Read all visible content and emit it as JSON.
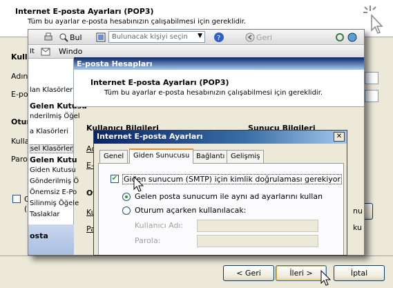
{
  "background_wizard": {
    "title": "Internet E-posta Ayarları (POP3)",
    "subtitle": "Tüm bu ayarlar e-posta hesabınızın çalışabilmesi için gereklidir.",
    "labels": [
      "Kull",
      "Adınız",
      "E-pos",
      "Otur",
      "Kullan",
      "Parol"
    ],
    "checkbox_fragment": "G",
    "paren_fragment": "(S",
    "back_button": "< Geri",
    "next_button": "İleri >",
    "cancel_button": "İptal"
  },
  "outlook": {
    "toolbar1": {
      "find_button": "Bul",
      "contact_search_placeholder": "Bulunacak kişiyi seçin",
      "back_button": "Geri"
    },
    "toolbar2": {
      "it_label": "It",
      "window_label": "Windo"
    },
    "folders": [
      "lan Klasörler",
      "Gelen Kutusu",
      "nderilmiş Öğel",
      "a Klasörleri",
      "sel Klasörler",
      "Gelen Kutu",
      "Giden Kutusu",
      "Gönderilmiş Ö",
      "Önemsiz E-Po",
      "Silinmiş Öğele",
      "Taslaklar",
      "osta"
    ],
    "accounts_window": {
      "title": "E-posta Hesapları",
      "heading": "Internet E-posta Ayarları (POP3)",
      "subheading": "Tüm bu ayarlar e-posta hesabınızın çalışabilmesi için gereklidir.",
      "user_info_label": "Kullanıcı Bilgileri",
      "server_info_label": "Sunucu Bilgileri",
      "fragments": [
        "Ad",
        "E-",
        "Ot",
        "Ku",
        "Pa"
      ],
      "right_fragments": [
        "nu",
        "ku"
      ]
    }
  },
  "dialog": {
    "title": "Internet E-posta Ayarları",
    "tabs": [
      "Genel",
      "Giden Sunucusu",
      "Bağlantı",
      "Gelişmiş"
    ],
    "active_tab": "Giden Sunucusu",
    "smtp_auth_label": "Giden sunucum (SMTP) için kimlik doğrulaması gerekiyor",
    "smtp_auth_checked": true,
    "radio_same_label": "Gelen posta sunucum ile aynı ad ayarlarını kullan",
    "radio_same_selected": true,
    "radio_logon_label": "Oturum açarken kullanılacak:",
    "username_label": "Kullanıcı Adı:",
    "password_label": "Parola:",
    "username_value": "",
    "password_value": ""
  }
}
